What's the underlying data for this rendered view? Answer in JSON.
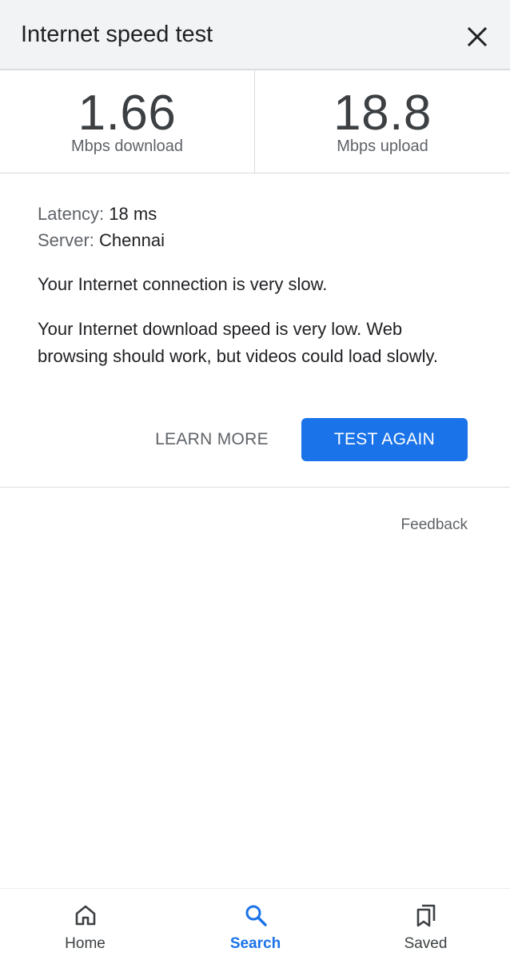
{
  "header": {
    "title": "Internet speed test"
  },
  "stats": {
    "download": {
      "value": "1.66",
      "unit": "Mbps download"
    },
    "upload": {
      "value": "18.8",
      "unit": "Mbps upload"
    }
  },
  "info": {
    "latency_label": "Latency: ",
    "latency_value": "18 ms",
    "server_label": "Server: ",
    "server_value": "Chennai"
  },
  "messages": {
    "summary": "Your Internet connection is very slow.",
    "detail": "Your Internet download speed is very low. Web browsing should work, but videos could load slowly."
  },
  "actions": {
    "learn_more": "LEARN MORE",
    "test_again": "TEST AGAIN"
  },
  "feedback": "Feedback",
  "nav": {
    "items": [
      {
        "label": "Home",
        "icon": "home-icon"
      },
      {
        "label": "Search",
        "icon": "search-icon",
        "active": true
      },
      {
        "label": "Saved",
        "icon": "bookmarks-icon"
      }
    ]
  },
  "colors": {
    "accent": "#1a73e8",
    "header_bg": "#f1f3f4",
    "text_primary": "#202124",
    "text_secondary": "#5f6368",
    "divider": "#dadce0"
  }
}
